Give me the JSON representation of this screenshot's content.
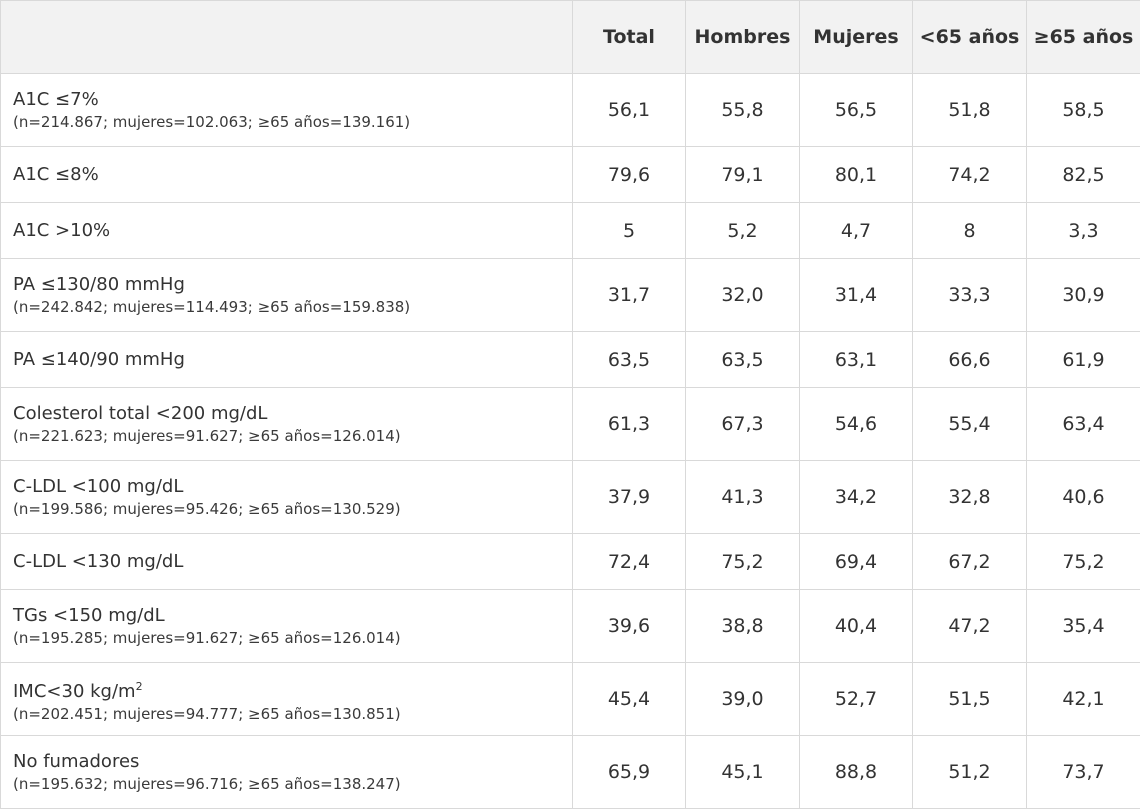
{
  "table": {
    "headers": [
      "",
      "Total",
      "Hombres",
      "Mujeres",
      "<65 años",
      "≥65 años"
    ],
    "rows": [
      {
        "label": "A1C ≤7%",
        "note": "(n=214.867; mujeres=102.063; ≥65 años=139.161)",
        "values": [
          "56,1",
          "55,8",
          "56,5",
          "51,8",
          "58,5"
        ]
      },
      {
        "label": "A1C ≤8%",
        "note": "",
        "values": [
          "79,6",
          "79,1",
          "80,1",
          "74,2",
          "82,5"
        ]
      },
      {
        "label": "A1C >10%",
        "note": "",
        "values": [
          "5",
          "5,2",
          "4,7",
          "8",
          "3,3"
        ]
      },
      {
        "label": "PA ≤130/80 mmHg",
        "note": "(n=242.842; mujeres=114.493; ≥65 años=159.838)",
        "values": [
          "31,7",
          "32,0",
          "31,4",
          "33,3",
          "30,9"
        ]
      },
      {
        "label": "PA ≤140/90 mmHg",
        "note": "",
        "values": [
          "63,5",
          "63,5",
          "63,1",
          "66,6",
          "61,9"
        ]
      },
      {
        "label": "Colesterol total <200 mg/dL",
        "note": "(n=221.623; mujeres=91.627; ≥65 años=126.014)",
        "values": [
          "61,3",
          "67,3",
          "54,6",
          "55,4",
          "63,4"
        ]
      },
      {
        "label": "C-LDL <100 mg/dL",
        "note": "(n=199.586; mujeres=95.426; ≥65 años=130.529)",
        "values": [
          "37,9",
          "41,3",
          "34,2",
          "32,8",
          "40,6"
        ]
      },
      {
        "label": "C-LDL <130 mg/dL",
        "note": "",
        "values": [
          "72,4",
          "75,2",
          "69,4",
          "67,2",
          "75,2"
        ]
      },
      {
        "label": "TGs <150 mg/dL",
        "note": "(n=195.285; mujeres=91.627; ≥65 años=126.014)",
        "values": [
          "39,6",
          "38,8",
          "40,4",
          "47,2",
          "35,4"
        ]
      },
      {
        "label": "IMC<30 kg/m",
        "label_sup": "2",
        "note": "(n=202.451; mujeres=94.777; ≥65 años=130.851)",
        "values": [
          "45,4",
          "39,0",
          "52,7",
          "51,5",
          "42,1"
        ]
      },
      {
        "label": "No fumadores",
        "note": "(n=195.632; mujeres=96.716; ≥65 años=138.247)",
        "values": [
          "65,9",
          "45,1",
          "88,8",
          "51,2",
          "73,7"
        ]
      }
    ]
  },
  "colors": {
    "header_bg": "#f2f2f2",
    "border": "#d9d9d9",
    "text": "#333333"
  }
}
